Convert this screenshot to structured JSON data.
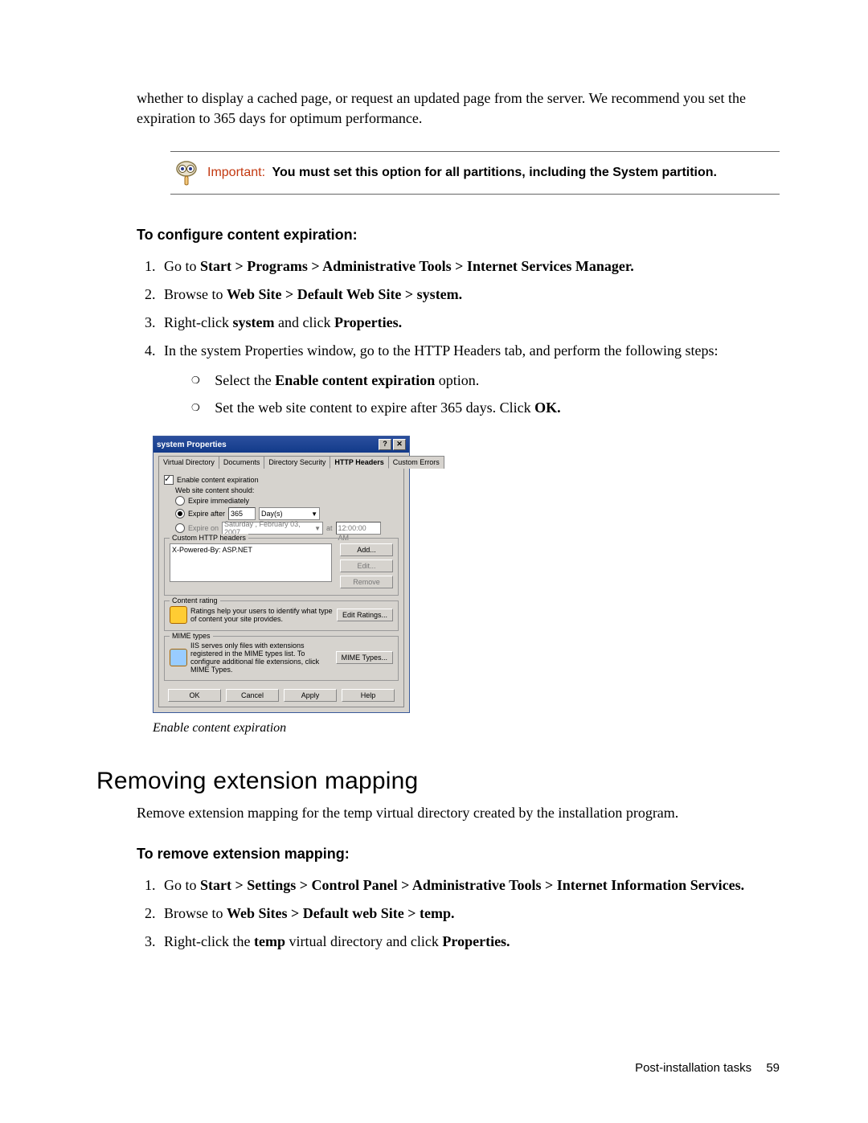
{
  "intro": "whether to display a cached page, or request an updated page from the server. We recommend you set the expiration to 365 days for optimum performance.",
  "callout": {
    "label": "Important:",
    "text": "You must set this option for all partitions, including the System partition."
  },
  "proc1": {
    "heading": "To configure content expiration:",
    "step1_pre": "Go to ",
    "step1_bold": "Start > Programs > Administrative Tools > Internet Services Manager.",
    "step2_pre": "Browse to ",
    "step2_bold": "Web Site > Default Web Site > system.",
    "step3_a": "Right-click ",
    "step3_b": "system",
    "step3_c": " and click ",
    "step3_d": "Properties.",
    "step4": "In the system Properties window, go to the HTTP Headers tab, and perform the following steps:",
    "sub1_a": "Select the ",
    "sub1_b": "Enable content expiration",
    "sub1_c": " option.",
    "sub2_a": "Set the web site content to expire after 365 days. Click ",
    "sub2_b": "OK."
  },
  "dlg": {
    "title": "system Properties",
    "help_btn": "?",
    "close_btn": "✕",
    "tabs": [
      "Virtual Directory",
      "Documents",
      "Directory Security",
      "HTTP Headers",
      "Custom Errors"
    ],
    "enable_ce": "Enable content expiration",
    "should": "Web site content should:",
    "expire_immediately": "Expire immediately",
    "expire_after": "Expire after",
    "expire_after_val": "365",
    "expire_after_unit": "Day(s)",
    "expire_on": "Expire on",
    "expire_on_date": "Saturday , February  03, 2007",
    "expire_on_at": "at",
    "expire_on_time": "12:00:00 AM",
    "custom_headers": "Custom HTTP headers",
    "xpowered": "X-Powered-By: ASP.NET",
    "add": "Add...",
    "edit": "Edit...",
    "remove": "Remove",
    "content_rating": "Content rating",
    "rating_text": "Ratings help your users to identify what type of content your site provides.",
    "edit_ratings": "Edit Ratings...",
    "mime_grp": "MIME types",
    "mime_text": "IIS serves only files with extensions registered in the MIME types list. To configure additional file extensions, click MIME Types.",
    "mime_btn": "MIME Types...",
    "ok": "OK",
    "cancel": "Cancel",
    "apply": "Apply",
    "help": "Help"
  },
  "caption": "Enable content expiration",
  "section2": {
    "title": "Removing extension mapping",
    "intro": "Remove extension mapping for the temp virtual directory created by the installation program.",
    "heading": "To remove extension mapping:",
    "step1_pre": "Go to ",
    "step1_bold": "Start > Settings > Control Panel > Administrative Tools > Internet Information Services.",
    "step2_pre": "Browse to ",
    "step2_bold": "Web Sites > Default web Site > temp.",
    "step3_a": "Right-click the ",
    "step3_b": "temp",
    "step3_c": " virtual directory and click ",
    "step3_d": "Properties."
  },
  "footer": {
    "label": "Post-installation tasks",
    "page": "59"
  }
}
